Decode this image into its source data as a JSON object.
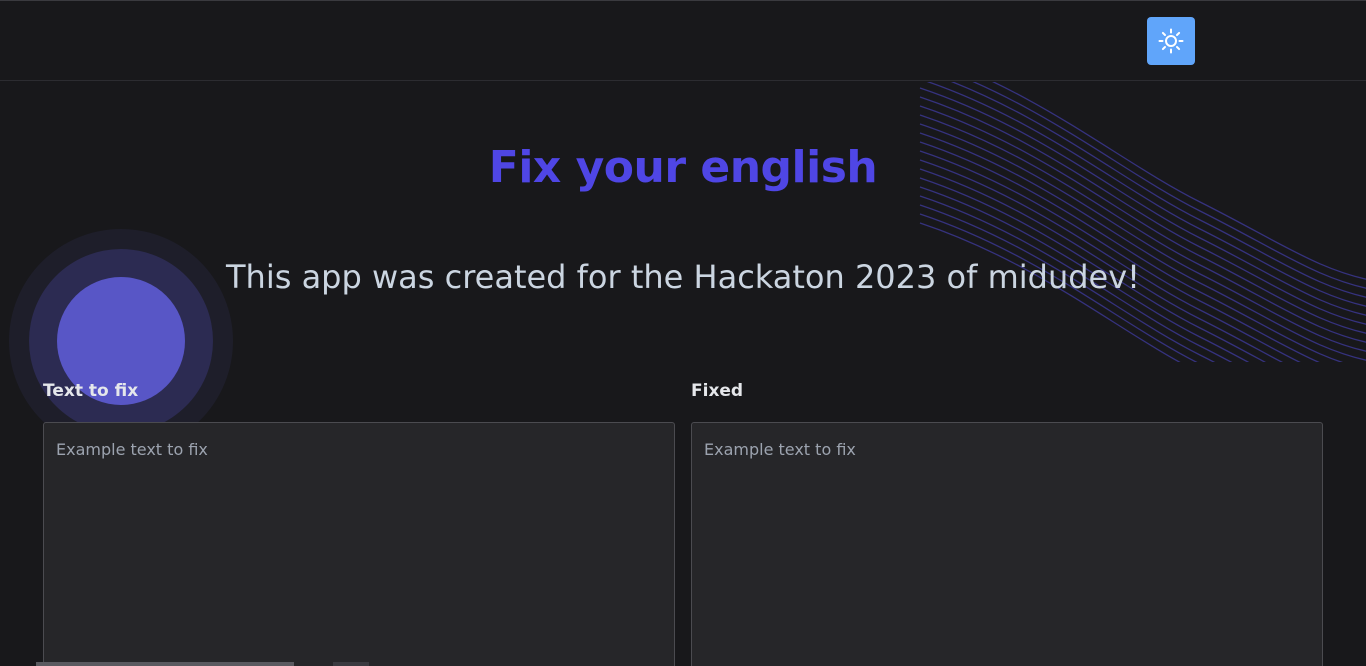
{
  "header": {
    "theme_toggle_icon": "sun-icon",
    "accent_color": "#60a5fa"
  },
  "hero": {
    "title": "Fix your english",
    "subtitle": "This app was created for the Hackaton 2023 of midudev!",
    "title_color": "#4f46e5"
  },
  "editor": {
    "input_label": "Text to fix",
    "input_placeholder": "Example text to fix",
    "output_label": "Fixed",
    "output_placeholder": "Example text to fix"
  }
}
